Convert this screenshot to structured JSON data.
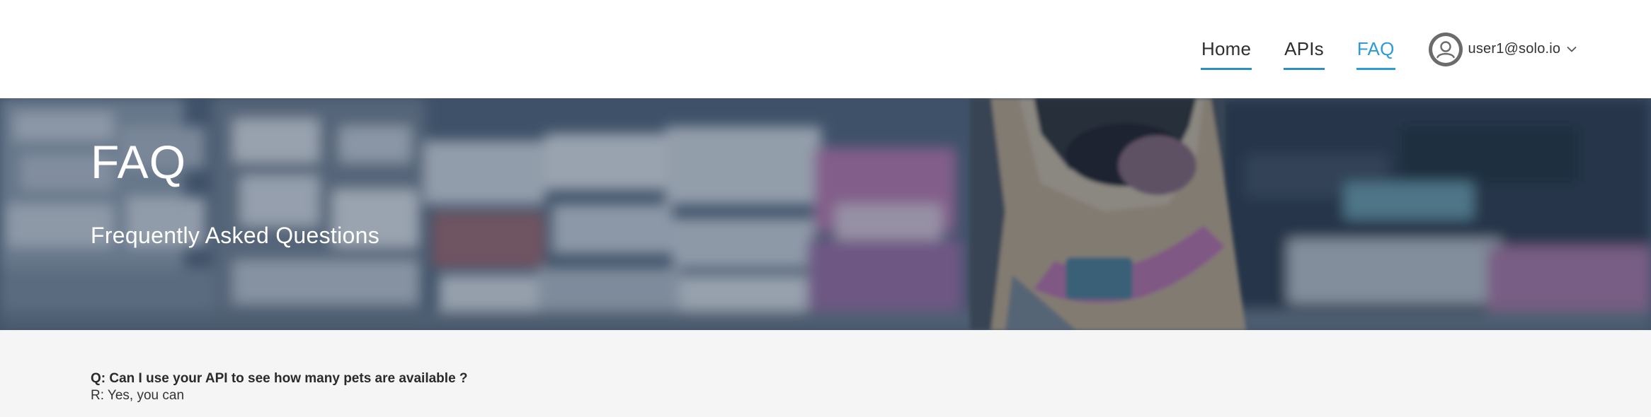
{
  "nav": {
    "links": [
      {
        "label": "Home",
        "active": false
      },
      {
        "label": "APIs",
        "active": false
      },
      {
        "label": "FAQ",
        "active": true
      }
    ],
    "user": {
      "email": "user1@solo.io",
      "avatar_icon": "user-circle-icon",
      "menu_icon": "chevron-down-icon"
    },
    "active_color": "#2d9bd6",
    "underline_color": "#2b8ec4"
  },
  "hero": {
    "title": "FAQ",
    "subtitle": "Frequently Asked Questions"
  },
  "faq": {
    "items": [
      {
        "question": "Q: Can I use your API to see how many pets are available ?",
        "answer": "R: Yes, you can"
      }
    ]
  }
}
